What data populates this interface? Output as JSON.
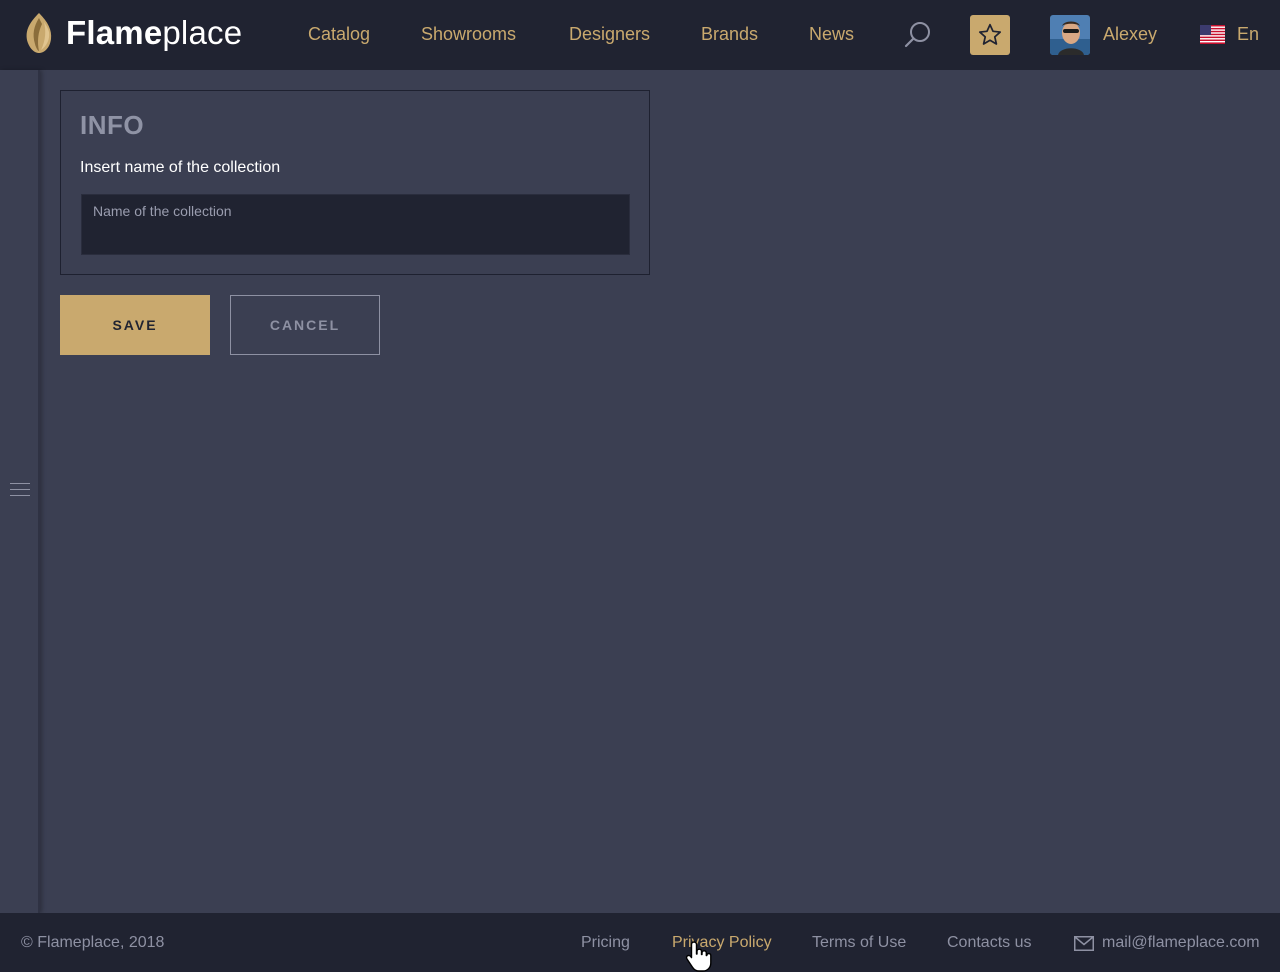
{
  "brand": {
    "bold": "Flame",
    "light": "place"
  },
  "nav": {
    "items": [
      "Catalog",
      "Showrooms",
      "Designers",
      "Brands",
      "News"
    ]
  },
  "user": {
    "name": "Alexey"
  },
  "language": {
    "label": "En"
  },
  "panel": {
    "title": "INFO",
    "label": "Insert name of the collection",
    "input_placeholder": "Name of the collection",
    "input_value": ""
  },
  "actions": {
    "save_label": "SAVE",
    "cancel_label": "CANCEL"
  },
  "footer": {
    "copyright": "© Flameplace, 2018",
    "links": [
      "Pricing",
      "Privacy Policy",
      "Terms of Use",
      "Contacts us"
    ],
    "email": "mail@flameplace.com"
  },
  "colors": {
    "accent": "#c9a96e",
    "header_bg": "#202331",
    "page_bg": "#3b3f52"
  },
  "icons": {
    "logo": "flame-logo-icon",
    "search": "search-icon",
    "favorites": "star-icon",
    "flag": "us-flag-icon",
    "menu": "hamburger-menu-icon",
    "mail": "mail-icon",
    "cursor": "hand-cursor-icon"
  }
}
